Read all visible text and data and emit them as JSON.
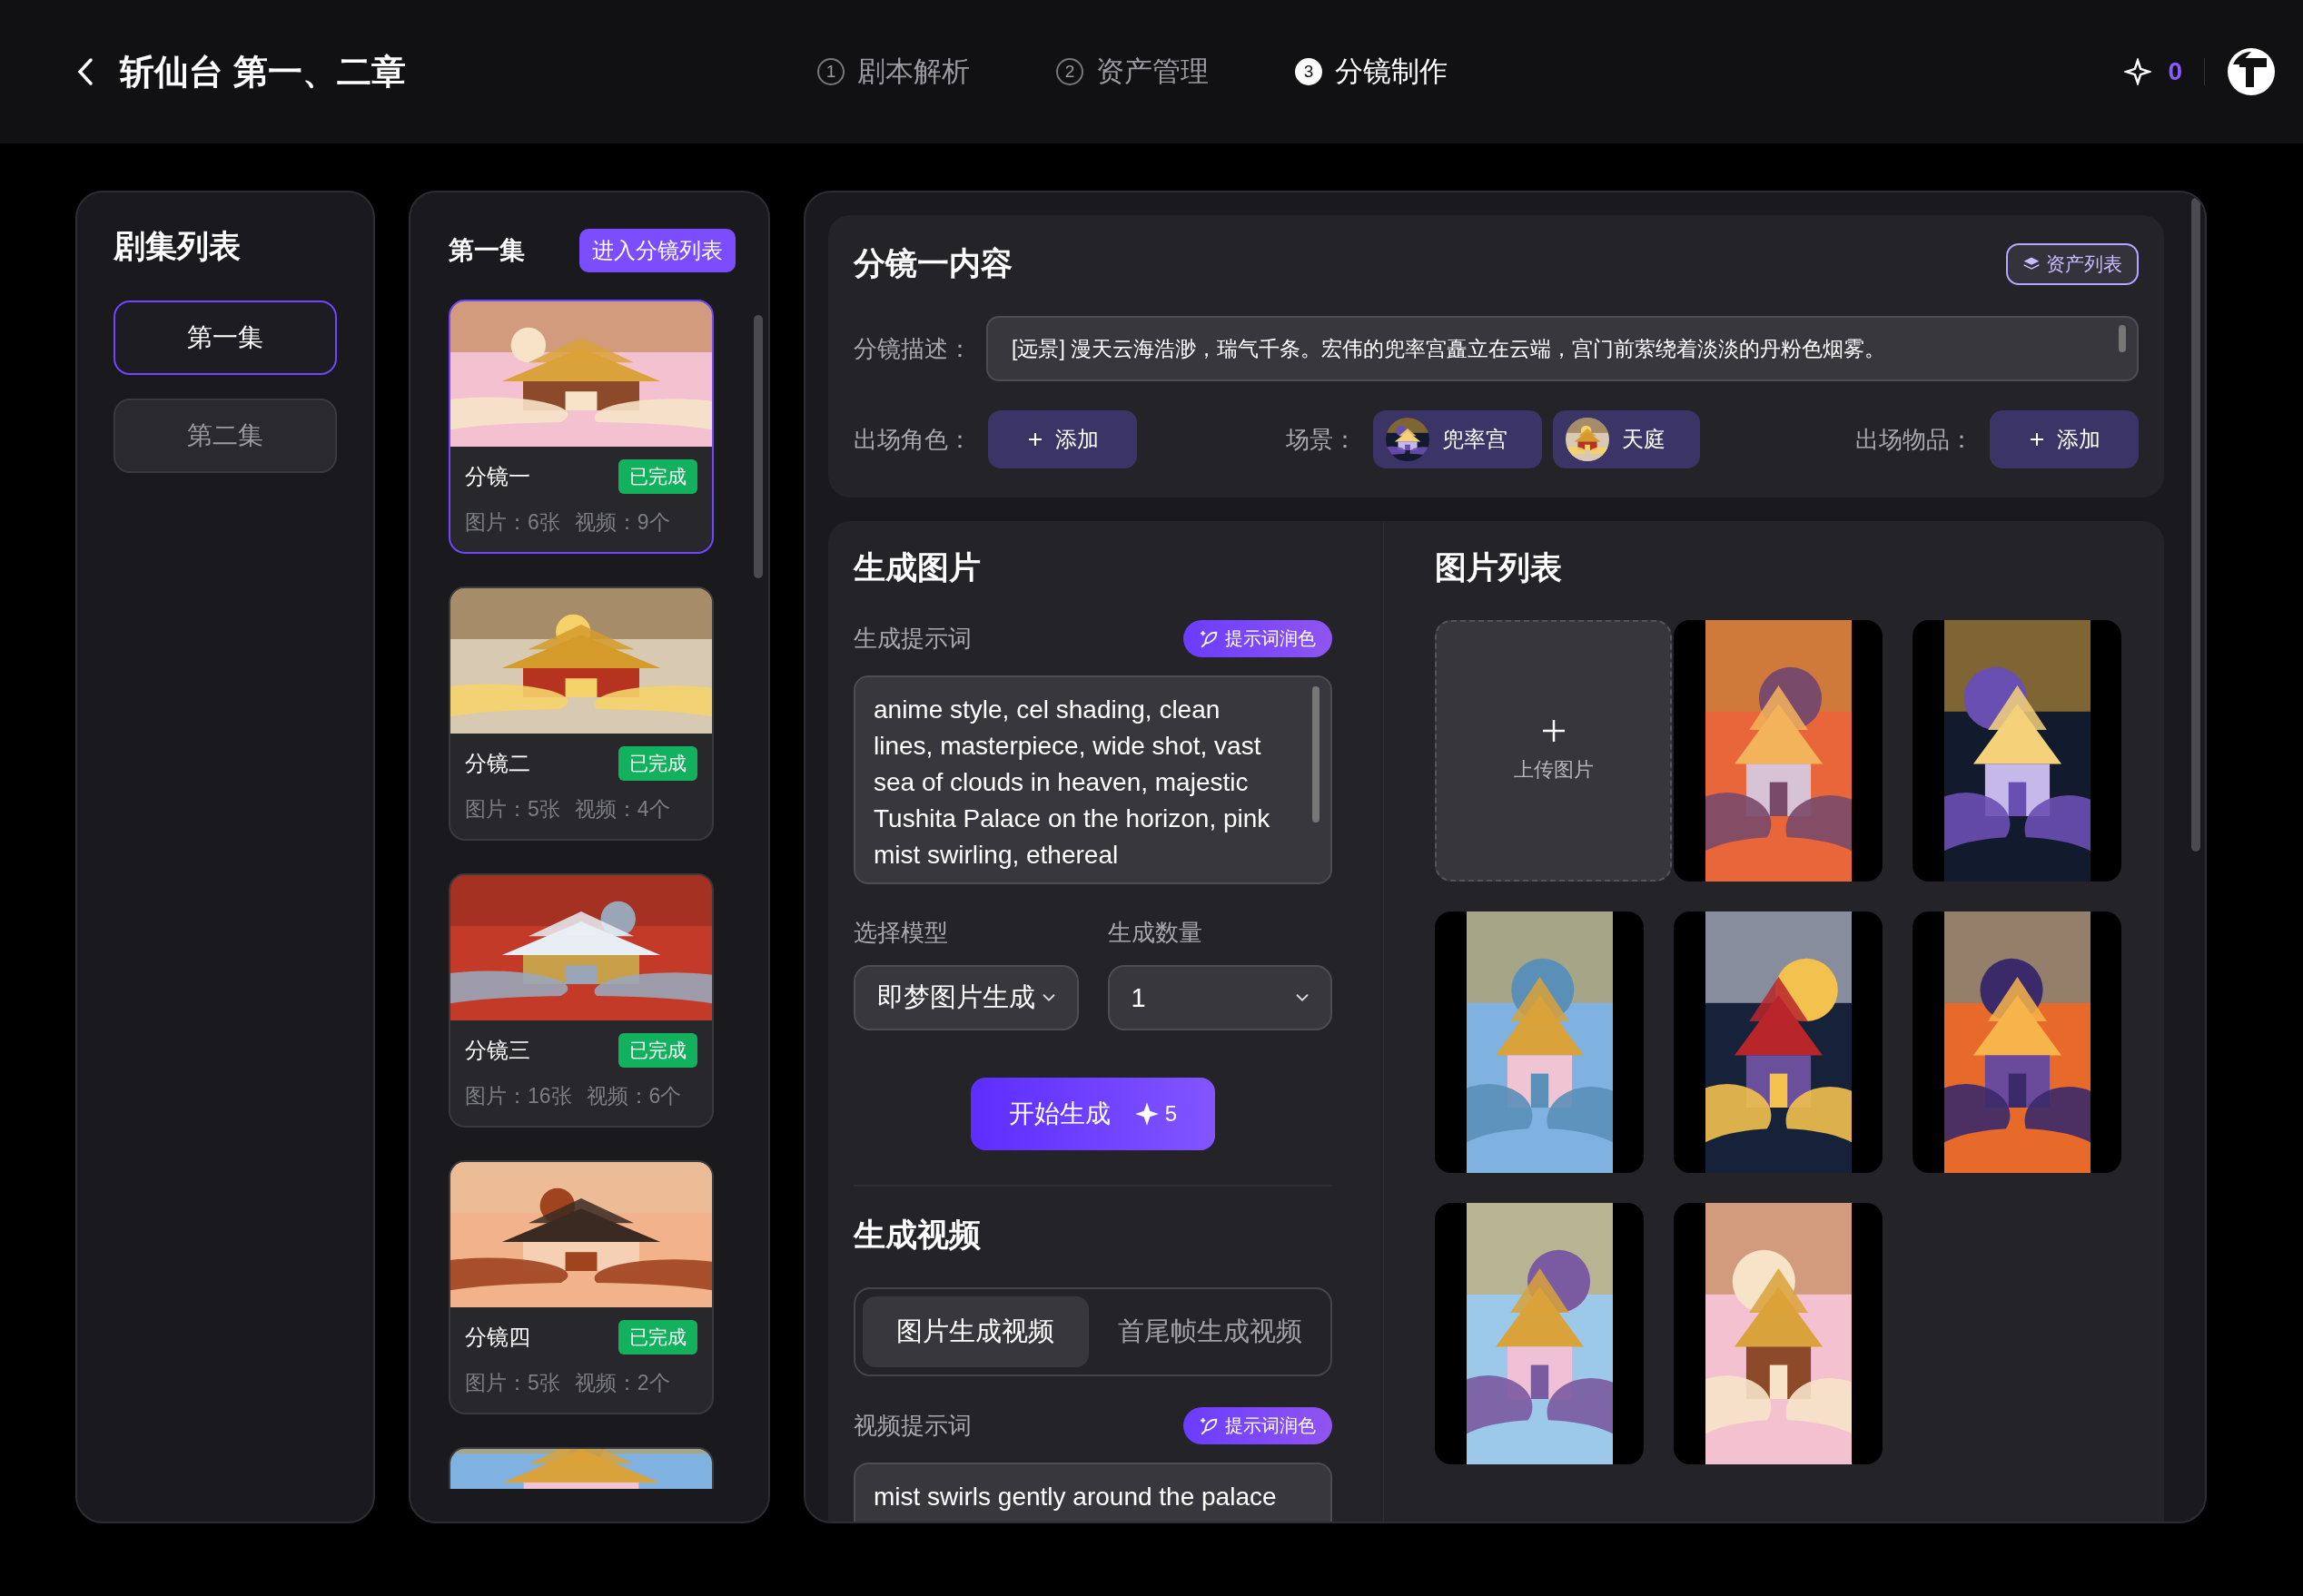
{
  "header": {
    "title": "斩仙台 第一、二章",
    "steps": [
      {
        "number": "1",
        "label": "剧本解析",
        "selected": false
      },
      {
        "number": "2",
        "label": "资产管理",
        "selected": false
      },
      {
        "number": "3",
        "label": "分镜制作",
        "selected": true
      }
    ],
    "credits": "0"
  },
  "episode_list": {
    "title": "剧集列表",
    "items": [
      {
        "label": "第一集",
        "selected": true
      },
      {
        "label": "第二集",
        "selected": false
      }
    ]
  },
  "shot_list": {
    "title": "第一集",
    "button": "进入分镜列表",
    "shots": [
      {
        "kind": "card",
        "title": "分镜一",
        "status": "已完成",
        "images": "图片：6张",
        "videos": "视频：9个",
        "selected": true
      },
      {
        "kind": "card",
        "title": "分镜二",
        "status": "已完成",
        "images": "图片：5张",
        "videos": "视频：4个",
        "selected": false
      },
      {
        "kind": "card",
        "title": "分镜三",
        "status": "已完成",
        "images": "图片：16张",
        "videos": "视频：6个",
        "selected": false
      },
      {
        "kind": "card",
        "title": "分镜四",
        "status": "已完成",
        "images": "图片：5张",
        "videos": "视频：2个",
        "selected": false
      },
      {
        "kind": "picture"
      }
    ]
  },
  "shot_content": {
    "title": "分镜一内容",
    "asset_button": "资产列表",
    "description_label": "分镜描述：",
    "description": "[远景] 漫天云海浩渺，瑞气千条。宏伟的兜率宫矗立在云端，宫门前萦绕着淡淡的丹粉色烟雾。",
    "characters": {
      "label": "出场角色：",
      "add_button": "添加"
    },
    "scenes": {
      "label": "场景：",
      "items": [
        {
          "name": "兜率宫"
        },
        {
          "name": "天庭"
        }
      ]
    },
    "props": {
      "label": "出场物品：",
      "add_button": "添加"
    }
  },
  "generate_image": {
    "title": "生成图片",
    "prompt_label": "生成提示词",
    "polish_button": "提示词润色",
    "prompt": "anime style, cel shading, clean lines, masterpiece, wide shot, vast sea of clouds in heaven, majestic Tushita Palace on the horizon, pink mist swirling, ethereal",
    "model_label": "选择模型",
    "model": "即梦图片生成",
    "count_label": "生成数量",
    "count": "1",
    "generate_button": "开始生成",
    "cost": "5"
  },
  "generate_video": {
    "title": "生成视频",
    "tabs": [
      {
        "label": "图片生成视频",
        "selected": true
      },
      {
        "label": "首尾帧生成视频",
        "selected": false
      }
    ],
    "prompt_label": "视频提示词",
    "polish_button": "提示词润色",
    "prompt": "mist swirls gently around the palace"
  },
  "image_list": {
    "title": "图片列表",
    "upload_label": "上传图片",
    "images": [
      {
        "kind": "picture"
      },
      {
        "kind": "picture"
      },
      {
        "kind": "picture"
      },
      {
        "kind": "picture"
      },
      {
        "kind": "picture"
      },
      {
        "kind": "picture"
      },
      {
        "kind": "picture"
      }
    ]
  }
}
